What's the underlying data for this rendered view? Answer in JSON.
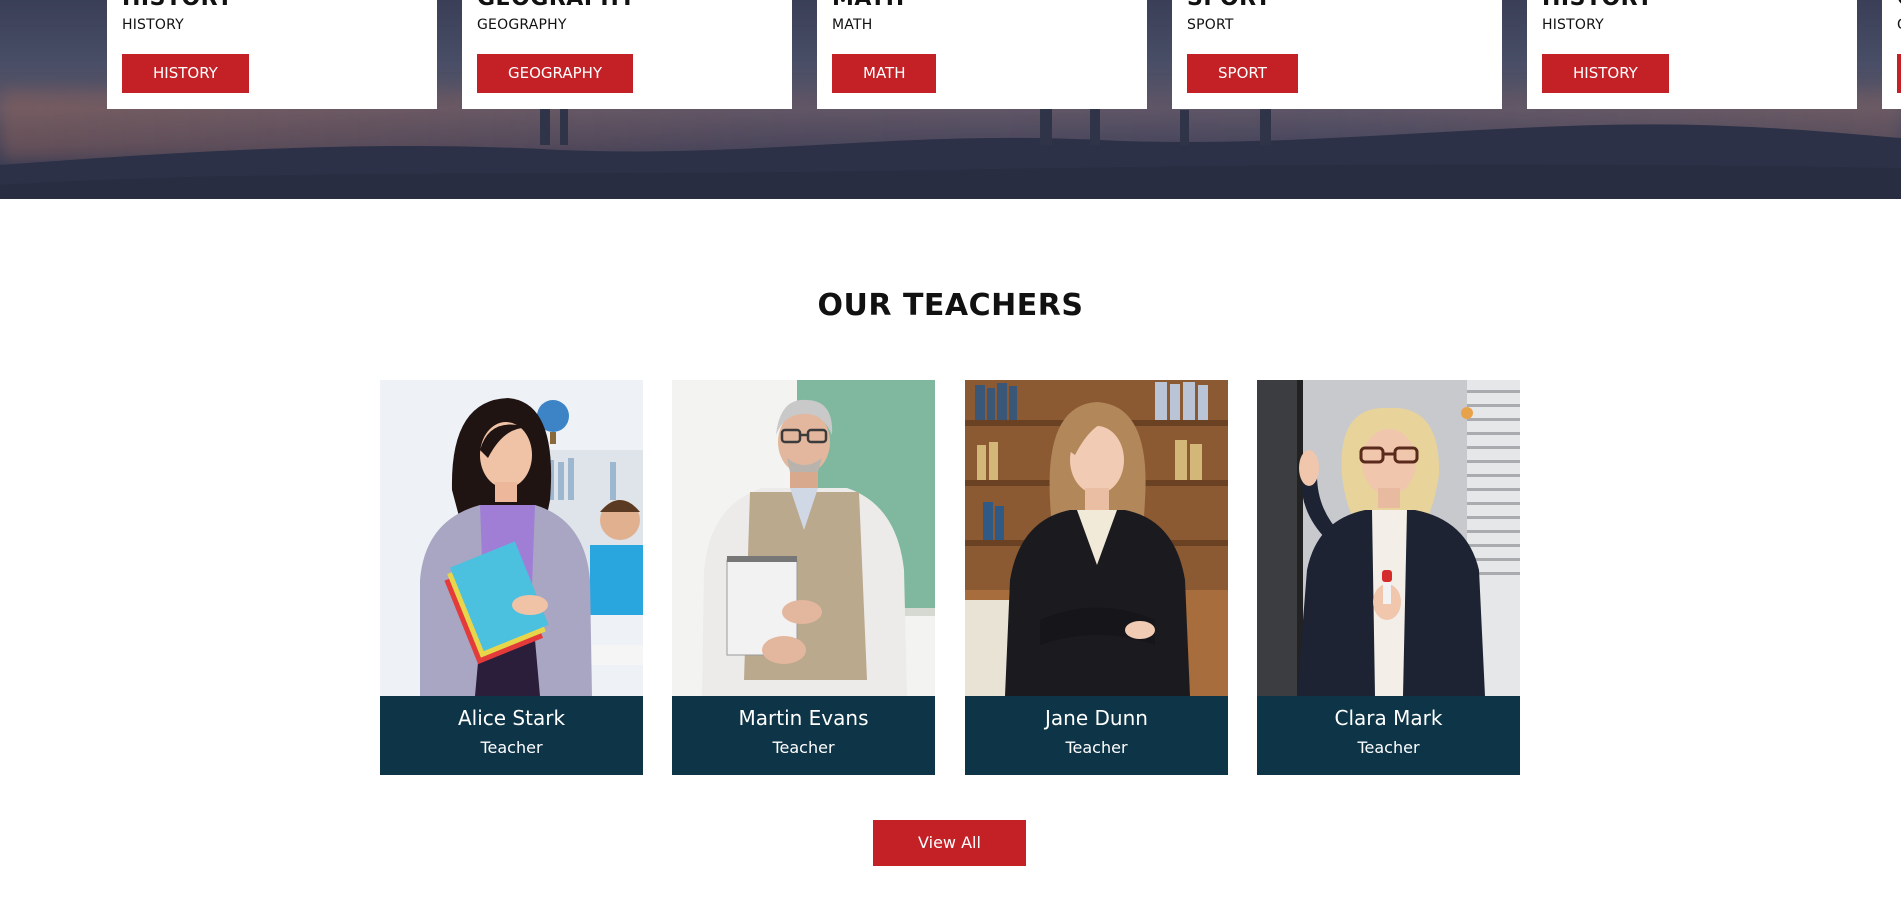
{
  "course_cards": [
    {
      "title": "HISTORY",
      "category": "HISTORY",
      "button": "HISTORY"
    },
    {
      "title": "GEOGRAPHY",
      "category": "GEOGRAPHY",
      "button": "GEOGRAPHY"
    },
    {
      "title": "MATH",
      "category": "MATH",
      "button": "MATH"
    },
    {
      "title": "SPORT",
      "category": "SPORT",
      "button": "SPORT"
    },
    {
      "title": "HISTORY",
      "category": "HISTORY",
      "button": "HISTORY"
    },
    {
      "title": "G",
      "category": "G",
      "button": ""
    }
  ],
  "teachers_section": {
    "title": "OUR TEACHERS",
    "teachers": [
      {
        "name": "Alice Stark",
        "role": "Teacher"
      },
      {
        "name": "Martin Evans",
        "role": "Teacher"
      },
      {
        "name": "Jane Dunn",
        "role": "Teacher"
      },
      {
        "name": "Clara Mark",
        "role": "Teacher"
      }
    ],
    "view_all_label": "View All"
  },
  "colors": {
    "accent_red": "#c32126",
    "teacher_card_footer": "#0e3547",
    "hero_overlay": "#3b3f58"
  }
}
